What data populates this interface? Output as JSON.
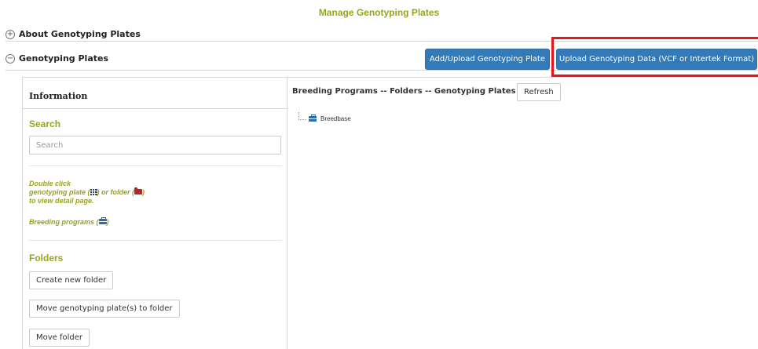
{
  "page": {
    "title": "Manage Genotyping Plates"
  },
  "sections": {
    "about": {
      "toggle": "+",
      "label": "About Genotyping Plates"
    },
    "plates": {
      "toggle": "−",
      "label": "Genotyping Plates"
    }
  },
  "toolbar": {
    "add_upload_label": "Add/Upload Genotyping Plate",
    "upload_data_label": "Upload Genotyping Data (VCF or Intertek Format)"
  },
  "info_panel": {
    "header": "Information",
    "search_heading": "Search",
    "search_placeholder": "Search",
    "hint_line1": "Double click",
    "hint_line2_a": "genotyping plate (",
    "hint_line2_b": ") or folder (",
    "hint_line2_c": ")",
    "hint_line3": "to view detail page.",
    "hint_programs_a": "Breeding programs (",
    "hint_programs_b": ")",
    "folders_heading": "Folders",
    "create_folder_label": "Create new folder",
    "move_plates_label": "Move genotyping plate(s) to folder",
    "move_folder_label": "Move folder"
  },
  "tree_panel": {
    "header": "Breeding Programs -- Folders -- Genotyping Plates",
    "refresh_label": "Refresh",
    "nodes": [
      {
        "label": "Breedbase",
        "icon": "briefcase-icon"
      }
    ]
  },
  "colors": {
    "accent_green": "#99a31f",
    "primary_blue": "#337ab7",
    "highlight_red": "#e8141c",
    "folder_red": "#b3262b"
  }
}
